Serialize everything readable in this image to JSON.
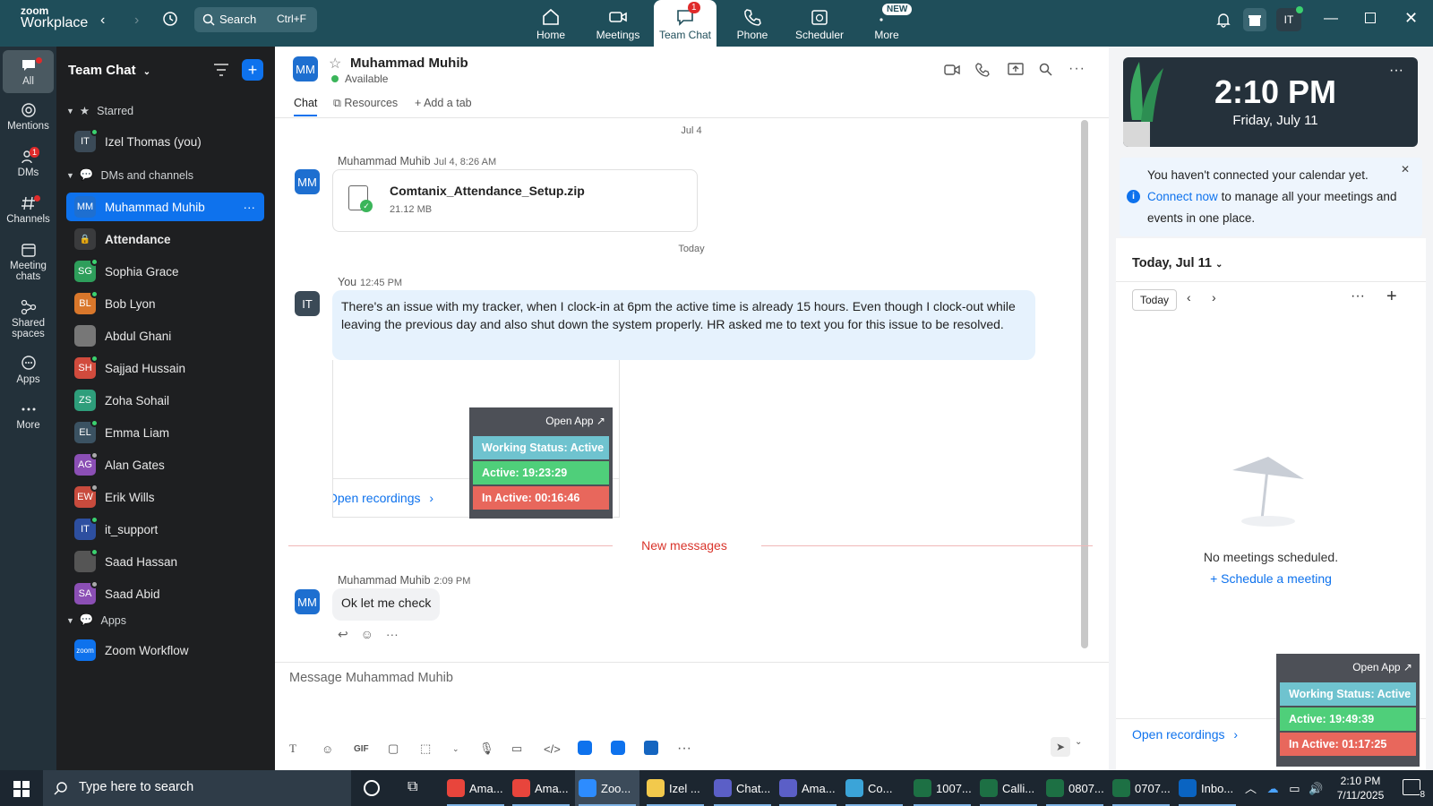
{
  "app": {
    "brand_top": "zoom",
    "brand_bottom": "Workplace"
  },
  "search": {
    "label": "Search",
    "shortcut": "Ctrl+F"
  },
  "nav_tabs": [
    {
      "label": "Home"
    },
    {
      "label": "Meetings"
    },
    {
      "label": "Team Chat",
      "badge": "1"
    },
    {
      "label": "Phone"
    },
    {
      "label": "Scheduler"
    },
    {
      "label": "More",
      "badge": "NEW"
    }
  ],
  "user_initials": "IT",
  "rail": [
    {
      "label": "All"
    },
    {
      "label": "Mentions"
    },
    {
      "label": "DMs",
      "badge": "1"
    },
    {
      "label": "Channels"
    },
    {
      "label": "Meeting chats"
    },
    {
      "label": "Shared spaces"
    },
    {
      "label": "Apps"
    },
    {
      "label": "More"
    }
  ],
  "sidebar": {
    "title": "Team Chat",
    "sections": {
      "starred": "Starred",
      "dms": "DMs and channels",
      "apps": "Apps"
    },
    "starred": [
      {
        "initials": "IT",
        "name": "Izel Thomas (you)"
      }
    ],
    "dms": [
      {
        "initials": "MM",
        "name": "Muhammad Muhib"
      },
      {
        "initials": "",
        "name": "Attendance"
      },
      {
        "initials": "SG",
        "name": "Sophia Grace"
      },
      {
        "initials": "BL",
        "name": "Bob Lyon"
      },
      {
        "initials": "",
        "name": "Abdul Ghani"
      },
      {
        "initials": "SH",
        "name": "Sajjad Hussain"
      },
      {
        "initials": "ZS",
        "name": "Zoha Sohail"
      },
      {
        "initials": "EL",
        "name": "Emma Liam"
      },
      {
        "initials": "AG",
        "name": "Alan Gates"
      },
      {
        "initials": "EW",
        "name": "Erik Wills"
      },
      {
        "initials": "IT",
        "name": "it_support"
      },
      {
        "initials": "",
        "name": "Saad Hassan"
      },
      {
        "initials": "SA",
        "name": "Saad Abid"
      }
    ],
    "apps": [
      {
        "initials": "zoom",
        "name": "Zoom Workflow"
      }
    ]
  },
  "chat": {
    "contact_initials": "MM",
    "contact_name": "Muhammad Muhib",
    "status": "Available",
    "tabs": [
      "Chat",
      "Resources",
      "Add a tab"
    ],
    "date1": "Jul 4",
    "msg1": {
      "name": "Muhammad Muhib",
      "time": "Jul 4, 8:26 AM",
      "file_name": "Comtanix_Attendance_Setup.zip",
      "file_size": "21.12 MB"
    },
    "date2": "Today",
    "msg2": {
      "initials": "IT",
      "name": "You",
      "time": "12:45 PM",
      "text": "There's an issue with my tracker, when I clock-in at 6pm the active time is already 15 hours. Even though I clock-out while leaving the previous day and also shut down the system properly. HR asked me to text you for this issue to be resolved.",
      "recordings": "Open recordings"
    },
    "overlay1": {
      "open_app": "Open App ↗",
      "status": "Working Status: Active",
      "active": "Active: 19:23:29",
      "inactive": "In Active: 00:16:46"
    },
    "new_messages": "New messages",
    "msg3": {
      "name": "Muhammad Muhib",
      "time": "2:09 PM",
      "text": "Ok let me check"
    },
    "composer_placeholder": "Message Muhammad Muhib"
  },
  "right": {
    "clock_time": "2:10 PM",
    "clock_date": "Friday, July 11",
    "notice_pre": "You haven't connected your calendar yet.",
    "notice_link": "Connect now",
    "notice_post": "to manage all your meetings and events in one place.",
    "today_header": "Today, Jul 11",
    "today_btn": "Today",
    "empty_text": "No meetings scheduled.",
    "schedule_link": "Schedule a meeting",
    "recordings": "Open recordings",
    "overlay2": {
      "open_app": "Open App ↗",
      "status": "Working Status: Active",
      "active": "Active: 19:49:39",
      "inactive": "In Active: 01:17:25"
    }
  },
  "taskbar": {
    "search_placeholder": "Type here to search",
    "apps": [
      {
        "label": "Ama...",
        "color": "#e8453c"
      },
      {
        "label": "Ama...",
        "color": "#e8453c"
      },
      {
        "label": "Zoo...",
        "color": "#2d8cff"
      },
      {
        "label": "Izel ...",
        "color": "#f2c94c"
      },
      {
        "label": "Chat...",
        "color": "#5b5fc7"
      },
      {
        "label": "Ama...",
        "color": "#5b5fc7"
      },
      {
        "label": "Co...",
        "color": "#3ba4d8"
      },
      {
        "label": "1007...",
        "color": "#1d7044"
      },
      {
        "label": "Calli...",
        "color": "#1d7044"
      },
      {
        "label": "0807...",
        "color": "#1d7044"
      },
      {
        "label": "0707...",
        "color": "#1d7044"
      },
      {
        "label": "Inbo...",
        "color": "#0a64c2"
      }
    ],
    "time": "2:10 PM",
    "date": "7/11/2025",
    "notif_count": "8"
  },
  "colors": {
    "accent": "#0e72ed",
    "topbar": "#1f4e5a",
    "active_green": "#4fcf7a",
    "inactive_red": "#e8675c",
    "status_teal": "#6fc3cf"
  }
}
